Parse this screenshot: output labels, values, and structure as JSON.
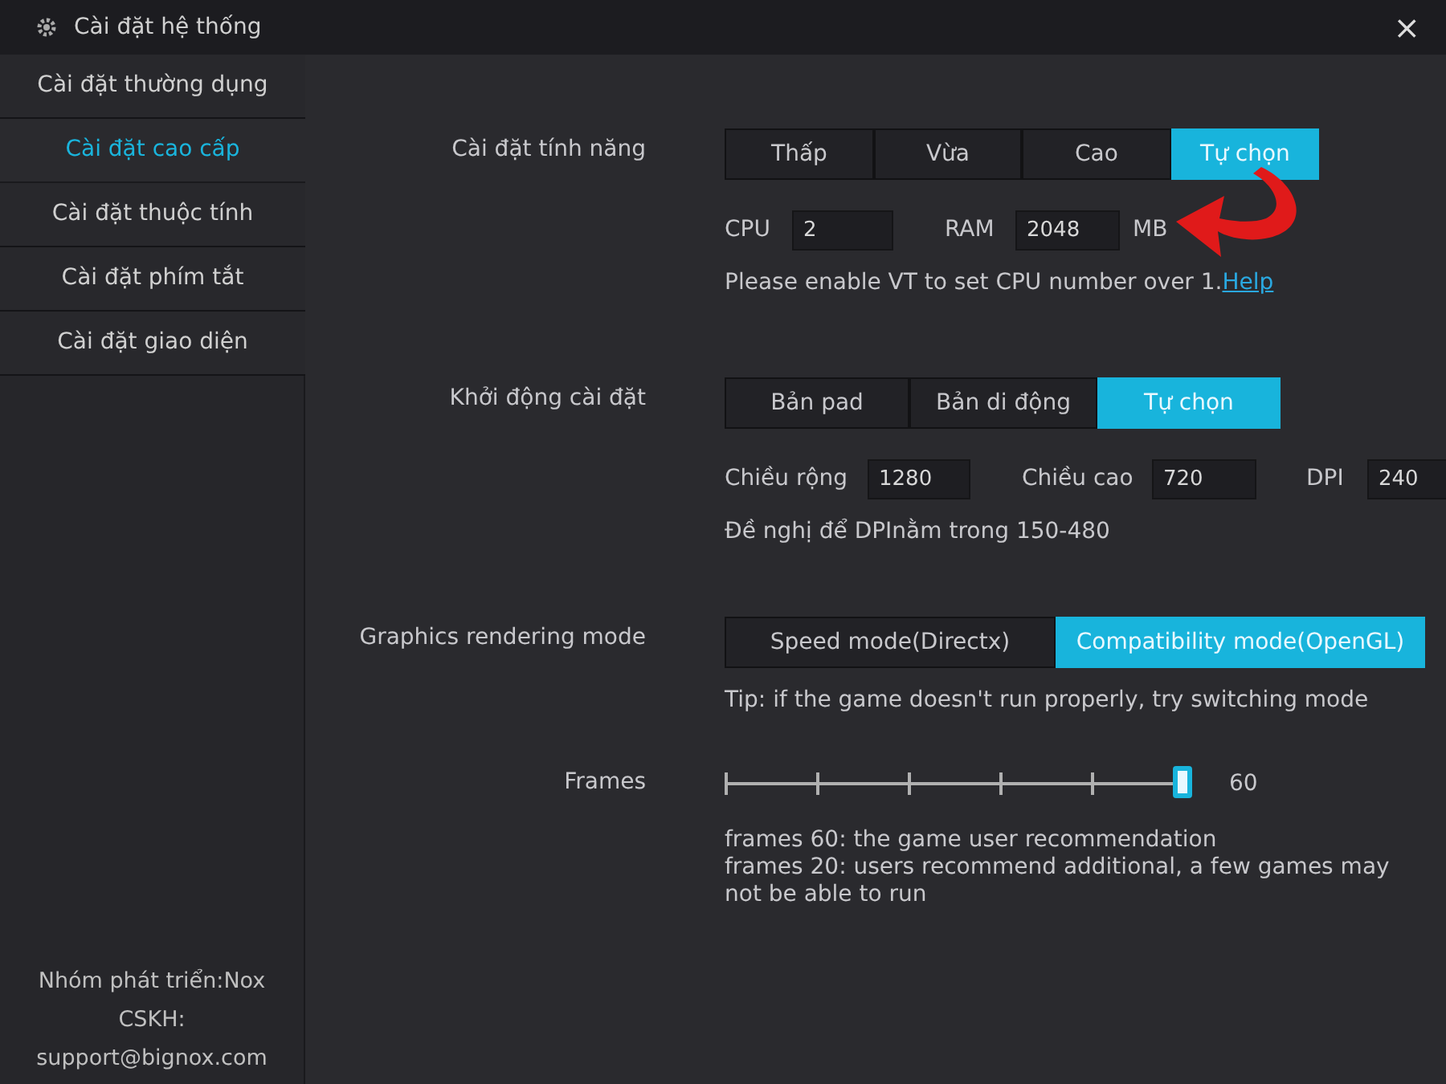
{
  "window": {
    "title": "Cài đặt hệ thống",
    "close": "×"
  },
  "sidebar": {
    "items": [
      {
        "label": "Cài đặt thường dụng",
        "selected": false
      },
      {
        "label": "Cài đặt cao cấp",
        "selected": true
      },
      {
        "label": "Cài đặt thuộc tính",
        "selected": false
      },
      {
        "label": "Cài đặt phím tắt",
        "selected": false
      },
      {
        "label": "Cài đặt giao diện",
        "selected": false
      }
    ],
    "footer": [
      "Nhóm phát triển:Nox",
      "CSKH:",
      "support@bignox.com"
    ]
  },
  "performance": {
    "label": "Cài đặt tính năng",
    "options": [
      {
        "label": "Thấp",
        "selected": false
      },
      {
        "label": "Vừa",
        "selected": false
      },
      {
        "label": "Cao",
        "selected": false
      },
      {
        "label": "Tự chọn",
        "selected": true
      }
    ],
    "fields": [
      {
        "label": "CPU",
        "value": "2"
      },
      {
        "label": "RAM",
        "value": "2048",
        "unit": "MB"
      }
    ],
    "hint": "Please enable VT to set CPU number over 1.",
    "link": "Help"
  },
  "startup": {
    "label": "Khởi động cài đặt",
    "options": [
      {
        "label": "Bản pad",
        "selected": false
      },
      {
        "label": "Bản di động",
        "selected": false
      },
      {
        "label": "Tự chọn",
        "selected": true
      }
    ],
    "fields": [
      {
        "label": "Chiều rộng",
        "value": "1280"
      },
      {
        "label": "Chiều cao",
        "value": "720"
      },
      {
        "label": "DPI",
        "value": "240"
      }
    ],
    "hint": "Đề nghị để DPInằm trong 150-480"
  },
  "graphics": {
    "label": "Graphics rendering mode",
    "options": [
      {
        "label": "Speed mode(Directx)",
        "selected": false
      },
      {
        "label": "Compatibility mode(OpenGL)",
        "selected": true
      }
    ],
    "tip": "Tip: if the game doesn't run properly, try switching mode"
  },
  "frames": {
    "label": "Frames",
    "level": 1,
    "reading": "60",
    "notes": [
      "frames 60: the game user recommendation",
      "frames 20: users recommend additional, a few games may not be able to run"
    ]
  }
}
